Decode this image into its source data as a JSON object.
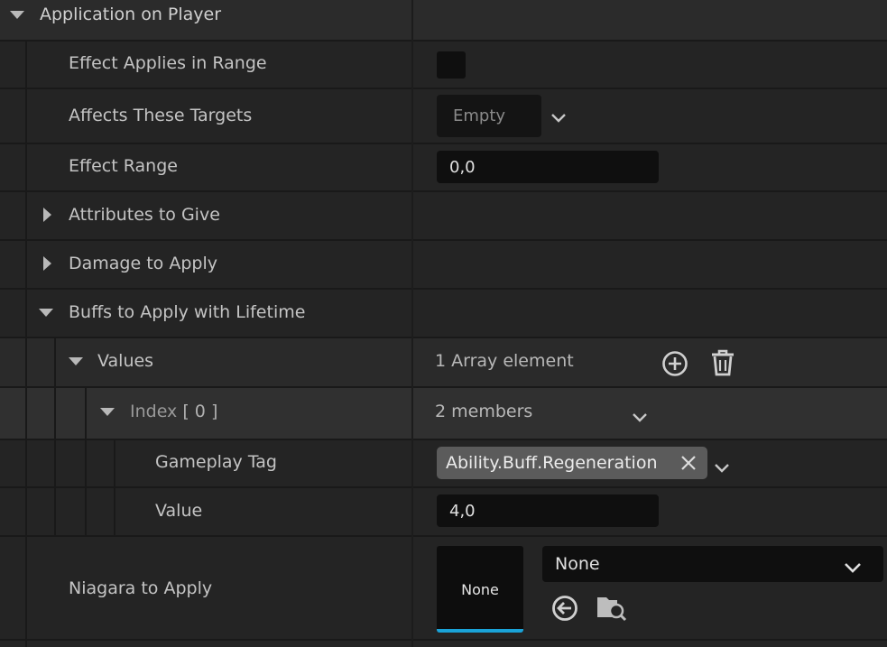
{
  "category": {
    "label": "Application on Player"
  },
  "properties": {
    "effect_applies_in_range": {
      "label": "Effect Applies in Range",
      "checked": false
    },
    "affects_these_targets": {
      "label": "Affects These Targets",
      "value": "Empty"
    },
    "effect_range": {
      "label": "Effect Range",
      "value": "0,0"
    },
    "attributes_to_give": {
      "label": "Attributes to Give",
      "expanded": false
    },
    "damage_to_apply": {
      "label": "Damage to Apply",
      "expanded": false
    },
    "buffs_to_apply": {
      "label": "Buffs to Apply with Lifetime",
      "expanded": true,
      "values": {
        "label": "Values",
        "summary": "1 Array element",
        "index": {
          "label": "Index",
          "index_number": "[ 0 ]",
          "summary": "2 members",
          "gameplay_tag": {
            "label": "Gameplay Tag",
            "value": "Ability.Buff.Regeneration"
          },
          "value": {
            "label": "Value",
            "value": "4,0"
          }
        }
      }
    },
    "niagara_to_apply": {
      "label": "Niagara to Apply",
      "thumbnail": "None",
      "value": "None"
    }
  },
  "icons": {
    "add": "add-element-icon",
    "delete": "trash-icon",
    "clear": "close-icon",
    "use_selected": "use-selected-arrow-icon",
    "browse": "browse-folder-icon"
  },
  "colors": {
    "accent": "#1aa3d8",
    "tag_bg": "#5b5b5b"
  }
}
